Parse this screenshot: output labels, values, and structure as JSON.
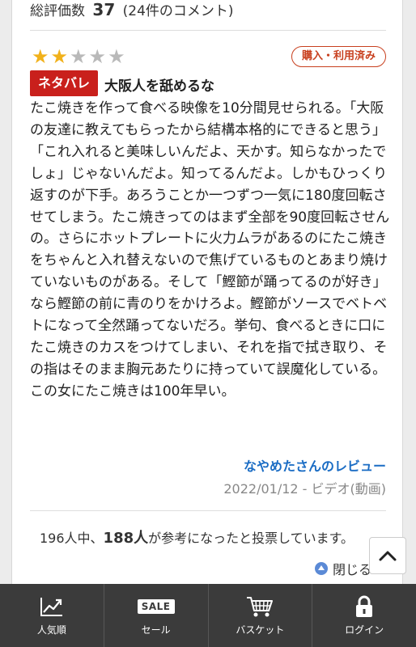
{
  "summary": {
    "label": "総評価数",
    "count": "37",
    "comments": "(24件のコメント)"
  },
  "review": {
    "rating": 2,
    "max_rating": 5,
    "purchase_badge": "購入・利用済み",
    "spoiler_badge": "ネタバレ",
    "title": "大阪人を舐めるな",
    "body": "たこ焼きを作って食べる映像を10分間見せられる。「大阪の友達に教えてもらったから結構本格的にできると思う」「これ入れると美味しいんだよ、天かす。知らなかったでしょ」じゃないんだよ。知ってるんだよ。しかもひっくり返すのが下手。あろうことか一つずつ一気に180度回転させてしまう。たこ焼きってのはまず全部を90度回転させんの。さらにホットプレートに火力ムラがあるのにたこ焼きをちゃんと入れ替えないので焦げているものとあまり焼けていないものがある。そして「鰹節が踊ってるのが好き」なら鰹節の前に青のりをかけろよ。鰹節がソースでベトベトになって全然踊ってないだろ。挙句、食べるときに口にたこ焼きのカスをつけてしまい、それを指で拭き取り、その指はそのまま胸元あたりに持っていて誤魔化している。この女にたこ焼きは100年早い。",
    "reviewer": "なやめたさんのレビュー",
    "meta": "2022/01/12 - ビデオ(動画)"
  },
  "helpful": {
    "prefix": "196人中、",
    "count": "188人",
    "suffix": "が参考になったと投票しています。"
  },
  "close_label": "閉じる",
  "nav": {
    "popular": "人気順",
    "sale_icon_text": "SALE",
    "sale": "セール",
    "basket": "バスケット",
    "login": "ログイン"
  },
  "colors": {
    "star_on": "#f1b11b",
    "star_off": "#b9b9b9",
    "spoiler_bg": "#c9201c",
    "badge_border": "#c8401f",
    "reviewer_link": "#1a6cc4",
    "navbar_bg": "#3b3b3b"
  },
  "icons": {
    "popular": "trending-chart-icon",
    "sale": "sale-tag-icon",
    "basket": "shopping-cart-icon",
    "login": "padlock-icon",
    "close": "up-arrow-circle-icon",
    "scroll_top": "chevron-up-icon"
  }
}
